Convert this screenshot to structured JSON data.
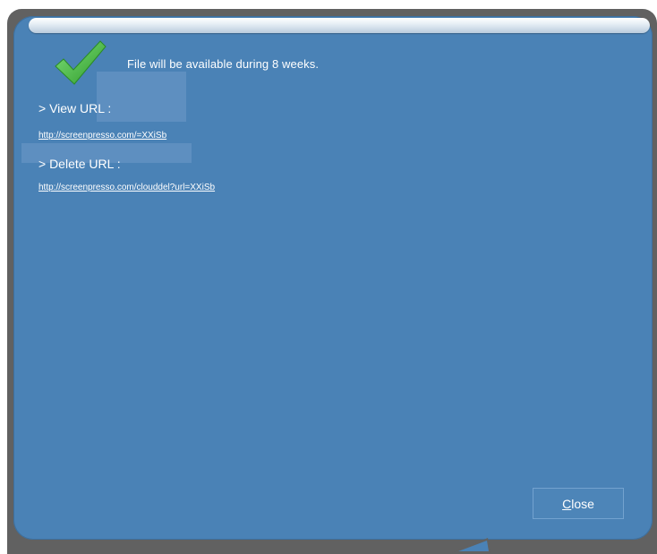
{
  "dialog": {
    "message": "File will be available during 8 weeks.",
    "view_url_label": "> View URL :",
    "view_url": "http://screenpresso.com/=XXiSb",
    "delete_url_label": "> Delete URL :",
    "delete_url": "http://screenpresso.com/clouddel?url=XXiSb",
    "close_button": {
      "mnemonic": "C",
      "rest": "lose"
    }
  },
  "icons": {
    "status": "checkmark-icon"
  },
  "colors": {
    "panel": "#4a82b6",
    "frame": "#616161",
    "text": "#ffffff",
    "check": "#3db838"
  }
}
